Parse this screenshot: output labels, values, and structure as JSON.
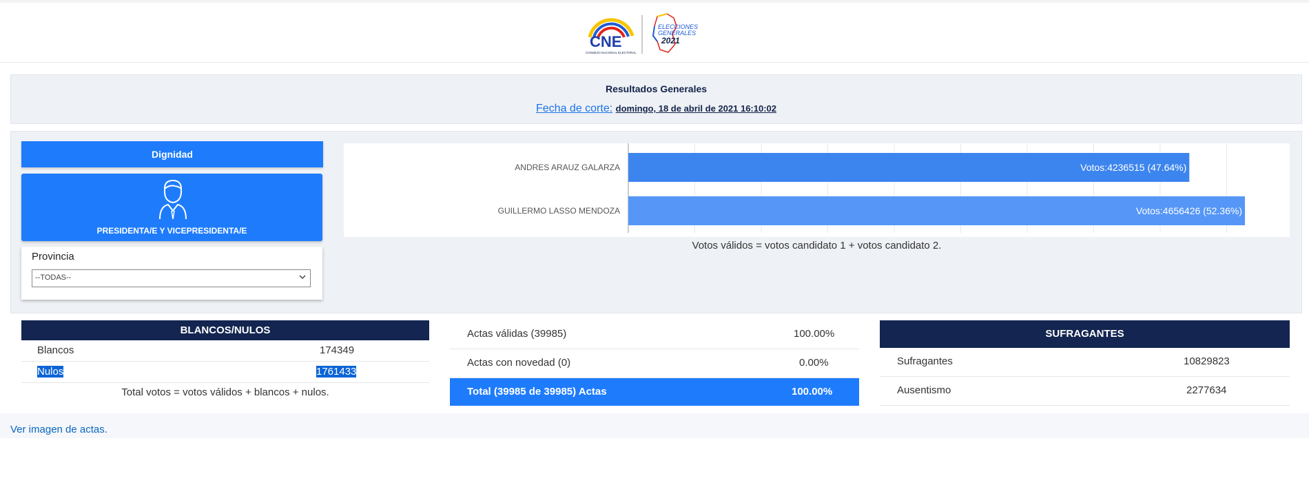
{
  "header": {
    "logo_cne": "CNE",
    "logo_cne_sub": "CONSEJO NACIONAL ELECTORAL",
    "logo_elecciones_1": "ELECCIONES",
    "logo_elecciones_2": "GENERALES",
    "logo_year": "2021"
  },
  "results": {
    "title": "Resultados Generales",
    "corte_label": "Fecha de corte:",
    "corte_value": "domingo, 18 de abril de 2021 16:10:02"
  },
  "dignidad": {
    "button_label": "Dignidad",
    "card_label": "PRESIDENTA/E Y VICEPRESIDENTA/E",
    "icon": "person-icon"
  },
  "provincia": {
    "label": "Provincia",
    "selected": "--TODAS--"
  },
  "chart_data": {
    "type": "bar",
    "orientation": "horizontal",
    "categories": [
      "ANDRES ARAUZ GALARZA",
      "GUILLERMO LASSO MENDOZA"
    ],
    "values": [
      4236515,
      4656426
    ],
    "percent": [
      47.64,
      52.36
    ],
    "data_labels": [
      "Votos:4236515 (47.64%)",
      "Votos:4656426 (52.36%)"
    ],
    "colors": [
      "#3d85ee",
      "#5596f7"
    ],
    "grid": true
  },
  "chart_note": "Votos válidos = votos candidato 1 + votos candidato 2.",
  "blancos_nulos": {
    "header": "BLANCOS/NULOS",
    "rows": [
      {
        "label": "Blancos",
        "value": "174349"
      },
      {
        "label": "Nulos",
        "value": "1761433"
      }
    ],
    "note": "Total votos = votos válidos + blancos + nulos."
  },
  "actas": {
    "rows": [
      {
        "label": "Actas válidas (39985)",
        "value": "100.00%"
      },
      {
        "label": "Actas con novedad (0)",
        "value": "0.00%"
      }
    ],
    "total_label": "Total (39985 de 39985) Actas",
    "total_value": "100.00%"
  },
  "sufragantes": {
    "header": "SUFRAGANTES",
    "rows": [
      {
        "label": "Sufragantes",
        "value": "10829823"
      },
      {
        "label": "Ausentismo",
        "value": "2277634"
      }
    ]
  },
  "ver_link": "Ver imagen de actas.",
  "colors": {
    "accent": "#1e7cfc",
    "navy": "#132550",
    "link": "#0a66c2"
  }
}
